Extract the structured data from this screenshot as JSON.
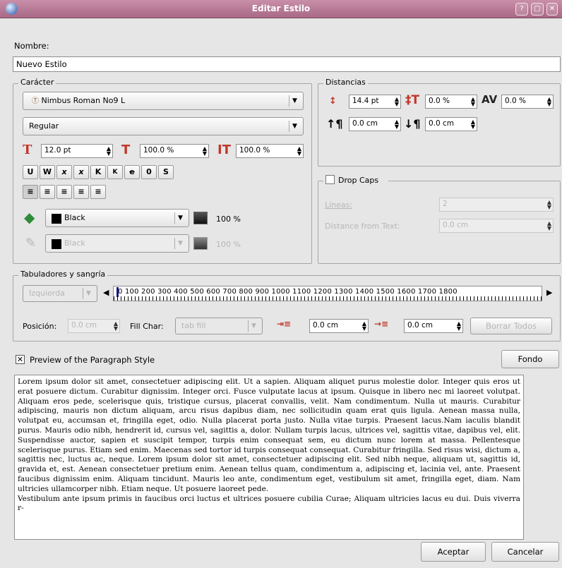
{
  "window": {
    "title": "Editar Estilo"
  },
  "nombre": {
    "label": "Nombre:",
    "value": "Nuevo Estilo"
  },
  "caracter": {
    "group_label": "Carácter",
    "font": "Nimbus Roman No9 L",
    "style": "Regular",
    "size": "12.0 pt",
    "scale_h": "100.0 %",
    "scale_v": "100.0 %",
    "effects": [
      "U",
      "W",
      "x",
      "x",
      "K",
      "K",
      "e",
      "0",
      "S"
    ],
    "fill_color": "Black",
    "fill_shade": "100 %",
    "stroke_color": "Black",
    "stroke_shade": "100 %"
  },
  "distancias": {
    "group_label": "Distancias",
    "line_spacing": "14.4 pt",
    "baseline": "0.0 %",
    "tracking": "0.0 %",
    "space_above": "0.0 cm",
    "space_below": "0.0 cm"
  },
  "dropcaps": {
    "label": "Drop Caps",
    "lines_label": "Líneas:",
    "lines_value": "2",
    "distance_label": "Distance from Text:",
    "distance_value": "0.0 cm"
  },
  "tabs": {
    "group_label": "Tabuladores y sangría",
    "alignment": "Izquierda",
    "ruler_numbers": "0    100  200  300  400  500  600  700  800  900  1000 1100 1200 1300 1400 1500 1600 1700 1800",
    "position_label": "Posición:",
    "position_value": "0.0 cm",
    "fill_char_label": "Fill Char:",
    "fill_char_value": "tab fill",
    "left_indent": "0.0 cm",
    "first_indent": "0.0 cm",
    "delete_all": "Borrar Todos"
  },
  "preview": {
    "checkbox_label": "Preview of the Paragraph Style",
    "background_button": "Fondo",
    "text": "Lorem ipsum dolor sit amet, consectetuer adipiscing elit. Ut a sapien. Aliquam aliquet purus molestie dolor. Integer quis eros ut erat posuere dictum. Curabitur dignissim. Integer orci. Fusce vulputate lacus at ipsum. Quisque in libero nec mi laoreet volutpat. Aliquam eros pede, scelerisque quis, tristique cursus, placerat convallis, velit. Nam condimentum. Nulla ut mauris. Curabitur adipiscing, mauris non dictum aliquam, arcu risus dapibus diam, nec sollicitudin quam erat quis ligula. Aenean massa nulla, volutpat eu, accumsan et, fringilla eget, odio. Nulla placerat porta justo. Nulla vitae turpis. Praesent lacus.Nam iaculis blandit purus. Mauris odio nibh, hendrerit id, cursus vel, sagittis a, dolor. Nullam turpis lacus, ultrices vel, sagittis vitae, dapibus vel, elit. Suspendisse auctor, sapien et suscipit tempor, turpis enim consequat sem, eu dictum nunc lorem at massa. Pellentesque scelerisque purus. Etiam sed enim. Maecenas sed tortor id turpis consequat consequat. Curabitur fringilla. Sed risus wisi, dictum a, sagittis nec, luctus ac, neque. Lorem ipsum dolor sit amet, consectetuer adipiscing elit. Sed nibh neque, aliquam ut, sagittis id, gravida et, est. Aenean consectetuer pretium enim. Aenean tellus quam, condimentum a, adipiscing et, lacinia vel, ante. Praesent faucibus dignissim enim. Aliquam tincidunt. Mauris leo ante, condimentum eget, vestibulum sit amet, fringilla eget, diam. Nam ultricies ullamcorper nibh. Etiam neque. Ut posuere laoreet pede.",
    "text2": "Vestibulum ante ipsum primis in faucibus orci luctus et ultrices posuere cubilia Curae; Aliquam ultricies lacus eu dui. Duis viverra r-"
  },
  "buttons": {
    "accept": "Aceptar",
    "cancel": "Cancelar"
  },
  "colors": {
    "titlebar": "#b87896",
    "background": "#e6e6e6"
  }
}
